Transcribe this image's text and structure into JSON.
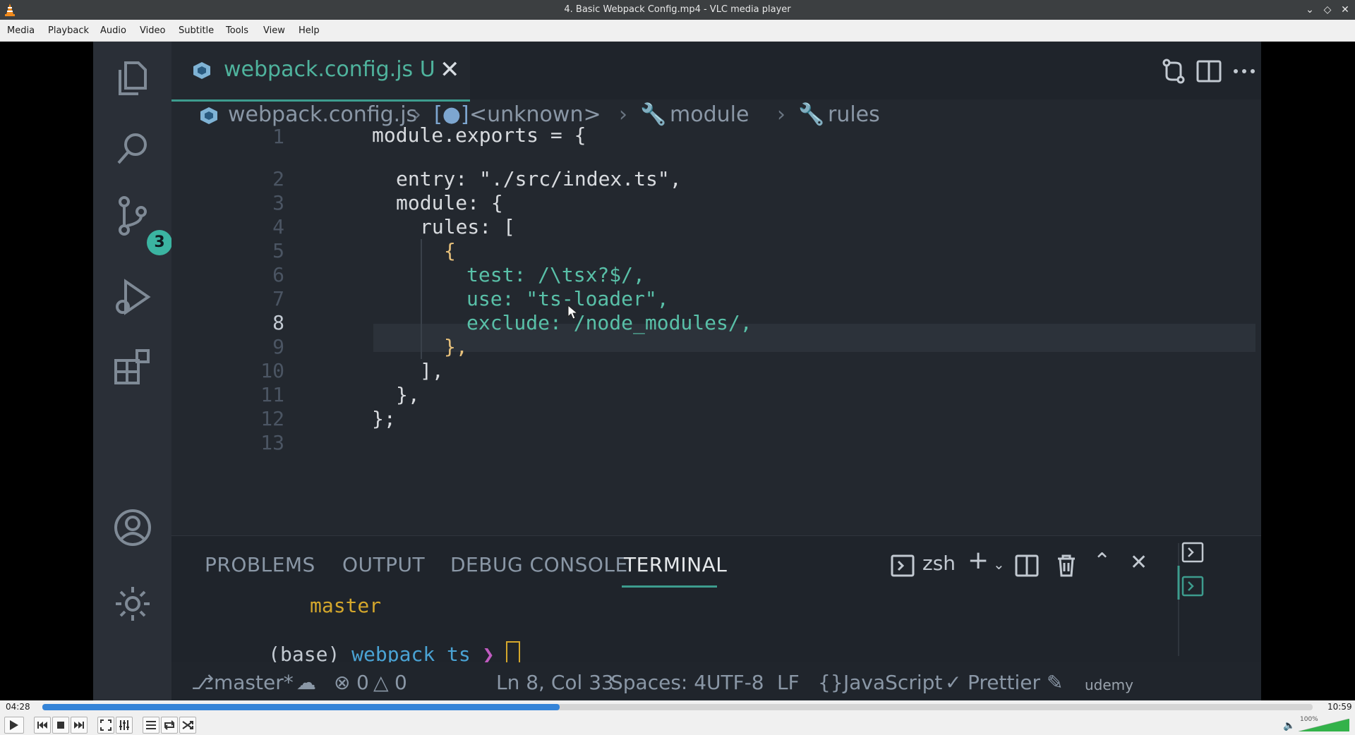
{
  "window": {
    "title": "4. Basic Webpack Config.mp4 - VLC media player"
  },
  "menu": [
    "Media",
    "Playback",
    "Audio",
    "Video",
    "Subtitle",
    "Tools",
    "View",
    "Help"
  ],
  "vscode": {
    "source_control_badge": "3",
    "tab": {
      "filename": "webpack.config.js",
      "status": "U"
    },
    "breadcrumb": [
      "webpack.config.js",
      "<unknown>",
      "module",
      "rules"
    ],
    "code_lines": [
      {
        "n": "1",
        "text": "module.exports = {"
      },
      {
        "n": "2",
        "text": "entry: \"./src/index.ts\","
      },
      {
        "n": "3",
        "text": "module: {"
      },
      {
        "n": "4",
        "text": "rules: ["
      },
      {
        "n": "5",
        "text": "{"
      },
      {
        "n": "6",
        "text": "test: /\\tsx?$/,"
      },
      {
        "n": "7",
        "text": "use: \"ts-loader\","
      },
      {
        "n": "8",
        "text": "exclude: /node_modules/,"
      },
      {
        "n": "9",
        "text": "},"
      },
      {
        "n": "10",
        "text": "],"
      },
      {
        "n": "11",
        "text": "},"
      },
      {
        "n": "12",
        "text": "};"
      },
      {
        "n": "13",
        "text": ""
      }
    ],
    "active_line": "8",
    "panel": {
      "tabs": [
        "PROBLEMS",
        "OUTPUT",
        "DEBUG CONSOLE",
        "TERMINAL"
      ],
      "active_tab": "TERMINAL",
      "shell": "zsh",
      "terminal_branch": "master",
      "terminal_prompt_env": "(base)",
      "terminal_prompt_dir": "webpack_ts",
      "terminal_prompt_arrow": "❯"
    },
    "status": {
      "branch": "master*",
      "errors": "0",
      "warnings": "0",
      "position": "Ln 8, Col 33",
      "spaces": "Spaces: 4",
      "encoding": "UTF-8",
      "eol": "LF",
      "language": "JavaScript",
      "formatter": "Prettier"
    },
    "watermark": "udemy"
  },
  "player": {
    "elapsed": "04:28",
    "duration": "10:59",
    "progress": 0.407,
    "volume_label": "100%",
    "volume": 1.0
  },
  "colors": {
    "accent": "#3d9c8e",
    "seek_fill": "#3584d8",
    "string": "#59c0a8",
    "branch": "#d4a72c"
  }
}
